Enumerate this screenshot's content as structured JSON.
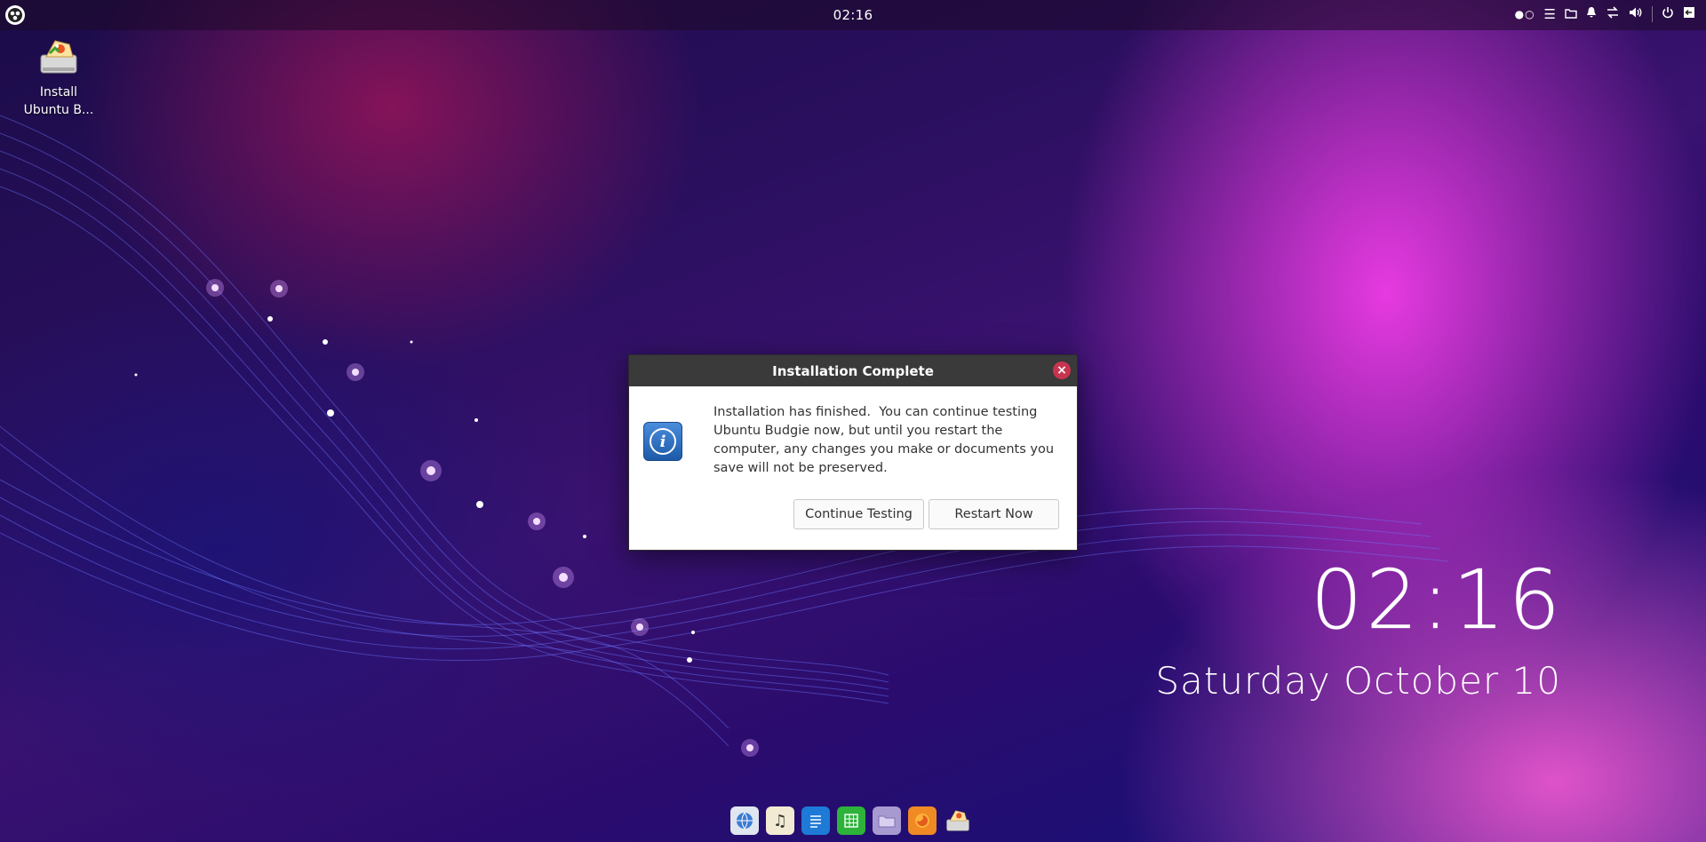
{
  "topbar": {
    "clock": "02:16",
    "workspace_indicator": "●○",
    "tray_icons": [
      "menu-lines-icon",
      "folder-icon",
      "bell-icon",
      "network-icon",
      "volume-icon",
      "power-icon",
      "exit-icon"
    ]
  },
  "desktop": {
    "icons": [
      {
        "label": "Install Ubuntu B...",
        "icon": "installer-icon"
      }
    ]
  },
  "dialog": {
    "title": "Installation Complete",
    "close_glyph": "×",
    "icon": "info-icon",
    "message": "Installation has finished.  You can continue testing Ubuntu Budgie now, but until you restart the computer, any changes you make or documents you save will not be preserved.",
    "buttons": {
      "continue": "Continue Testing",
      "restart": "Restart Now"
    }
  },
  "desktop_clock": {
    "time": "02:16",
    "date": "Saturday October 10"
  },
  "dock": {
    "apps": [
      {
        "name": "browser-icon",
        "color": "#dfe6f0"
      },
      {
        "name": "music-icon",
        "color": "#f2ead2"
      },
      {
        "name": "writer-icon",
        "color": "#1d7ad6"
      },
      {
        "name": "calc-icon",
        "color": "#2eb33a"
      },
      {
        "name": "files-icon",
        "color": "#a79ad0"
      },
      {
        "name": "firefox-icon",
        "color": "#f08a24"
      },
      {
        "name": "installer-icon",
        "color": "#c8c8c8"
      }
    ]
  }
}
